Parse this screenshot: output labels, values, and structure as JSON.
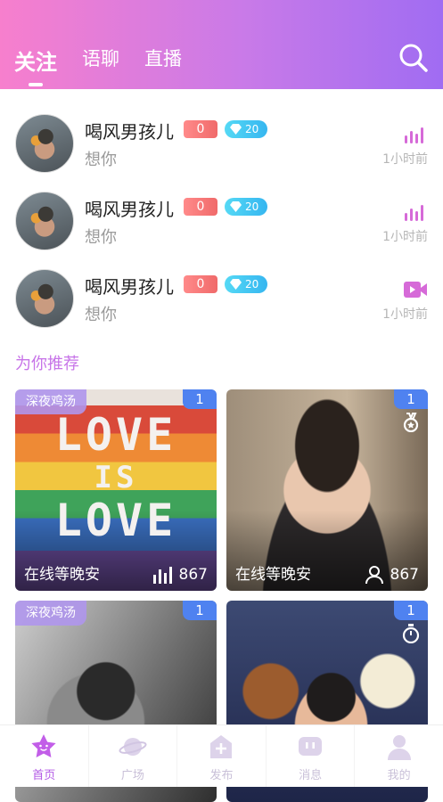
{
  "header": {
    "tabs": [
      {
        "label": "关注",
        "active": true
      },
      {
        "label": "语聊",
        "active": false
      },
      {
        "label": "直播",
        "active": false
      }
    ],
    "search_icon": "search-icon",
    "gradient": [
      "#f77fcd",
      "#a06cf2"
    ]
  },
  "messages": [
    {
      "name": "喝风男孩儿",
      "red_badge": "0",
      "diamond_badge": "20",
      "text": "想你",
      "time": "1小时前",
      "state_icon": "audio-wave-icon"
    },
    {
      "name": "喝风男孩儿",
      "red_badge": "0",
      "diamond_badge": "20",
      "text": "想你",
      "time": "1小时前",
      "state_icon": "audio-wave-icon"
    },
    {
      "name": "喝风男孩儿",
      "red_badge": "0",
      "diamond_badge": "20",
      "text": "想你",
      "time": "1小时前",
      "state_icon": "video-camera-icon"
    }
  ],
  "recommend": {
    "title": "为你推荐",
    "cards": [
      {
        "tag": "深夜鸡汤",
        "rank": "1",
        "caption": "在线等晚安",
        "count": "867",
        "count_icon": "audio-bars-icon",
        "photo_text": [
          "LOVE",
          "IS",
          "LOVE"
        ]
      },
      {
        "tag": "",
        "rank": "1",
        "caption": "在线等晚安",
        "count": "867",
        "count_icon": "person-icon",
        "corner_icon": "medal-icon"
      },
      {
        "tag": "深夜鸡汤",
        "rank": "1",
        "caption": "",
        "count": ""
      },
      {
        "tag": "",
        "rank": "1",
        "caption": "",
        "count": "",
        "corner_icon": "timer-icon"
      }
    ]
  },
  "tabbar": {
    "items": [
      {
        "label": "首页",
        "icon": "star-home-icon",
        "active": true
      },
      {
        "label": "广场",
        "icon": "planet-icon",
        "active": false
      },
      {
        "label": "发布",
        "icon": "publish-plus-icon",
        "active": false
      },
      {
        "label": "消息",
        "icon": "message-icon",
        "active": false
      },
      {
        "label": "我的",
        "icon": "profile-icon",
        "active": false
      }
    ],
    "active_color": "#b35ae6",
    "inactive_color": "#d9cfe6"
  }
}
